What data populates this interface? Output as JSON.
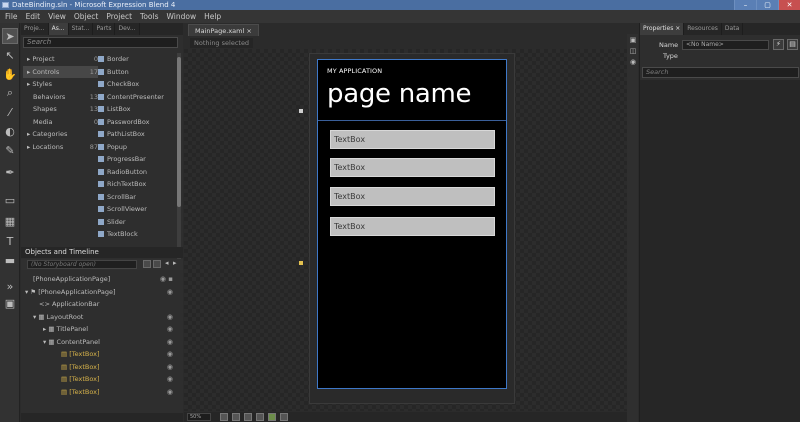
{
  "titlebar": {
    "title": "DateBinding.sln - Microsoft Expression Blend 4",
    "min": "–",
    "max": "▢",
    "close": "✕"
  },
  "menu": [
    "File",
    "Edit",
    "View",
    "Object",
    "Project",
    "Tools",
    "Window",
    "Help"
  ],
  "tools": {
    "icons": [
      "selection-icon",
      "direct-selection-icon",
      "pan-icon",
      "zoom-icon",
      "eyedropper-icon",
      "paint-bucket-icon",
      "brush-icon",
      "pen-icon",
      "rectangle-icon",
      "layout-grid-icon",
      "text-icon",
      "control-icon",
      "asset-tool-icon",
      "assets-icon"
    ]
  },
  "left_panel": {
    "tabs": [
      "Proje...",
      "As...",
      "Stat...",
      "Parts",
      "Dev..."
    ],
    "search_placeholder": "Search",
    "categories": [
      {
        "label": "▸ Project",
        "count": "0"
      },
      {
        "label": "▸ Controls",
        "count": "17"
      },
      {
        "label": "▸ Styles",
        "count": ""
      },
      {
        "label": "Behaviors",
        "count": "13"
      },
      {
        "label": "Shapes",
        "count": "13"
      },
      {
        "label": "Media",
        "count": "0"
      },
      {
        "label": "▸ Categories",
        "count": ""
      },
      {
        "label": "▸ Locations",
        "count": "87"
      }
    ],
    "assets": [
      "Border",
      "Button",
      "CheckBox",
      "ContentPresenter",
      "ListBox",
      "PasswordBox",
      "PathListBox",
      "Popup",
      "ProgressBar",
      "RadioButton",
      "RichTextBox",
      "ScrollBar",
      "ScrollViewer",
      "Slider",
      "TextBlock"
    ]
  },
  "objects": {
    "title": "Objects and Timeline",
    "search_placeholder": "(No Storyboard open)",
    "rows": [
      {
        "label": "[PhoneApplicationPage]",
        "indent": 0
      },
      {
        "label": "▾ ⚑ [PhoneApplicationPage]",
        "indent": 0
      },
      {
        "label": "<> ApplicationBar",
        "indent": 1
      },
      {
        "label": "▾ ▦ LayoutRoot",
        "indent": 1
      },
      {
        "label": "▸ ▦ TitlePanel",
        "indent": 2
      },
      {
        "label": "▾ ▦ ContentPanel",
        "indent": 2
      },
      {
        "label": "▤ [TextBox]",
        "indent": 3
      },
      {
        "label": "▤ [TextBox]",
        "indent": 3
      },
      {
        "label": "▤ [TextBox]",
        "indent": 3
      },
      {
        "label": "▤ [TextBox]",
        "indent": 3
      }
    ]
  },
  "document": {
    "tab": "MainPage.xaml ×",
    "breadcrumb": "Nothing selected",
    "zoom": "50%"
  },
  "phone": {
    "app_name": "MY APPLICATION",
    "page_name": "page name",
    "textboxes": [
      "TextBox",
      "TextBox",
      "TextBox",
      "TextBox"
    ]
  },
  "properties": {
    "tabs": [
      "Properties ×",
      "Resources",
      "Data"
    ],
    "name_label": "Name",
    "name_value": "<No Name>",
    "type_label": "Type",
    "type_value": "",
    "search_placeholder": "Search"
  }
}
